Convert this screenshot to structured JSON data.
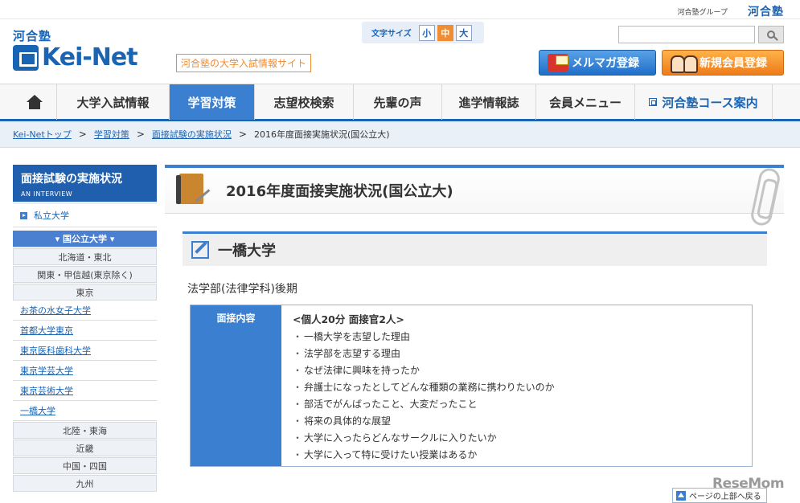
{
  "topbar": {
    "group_label": "河合塾グループ",
    "kawai_logo": "河合塾"
  },
  "logo": {
    "kawai": "河合塾",
    "brand": "Kei-Net",
    "tagline": "河合塾の大学入試情報サイト"
  },
  "font_size": {
    "label": "文字サイズ",
    "options": [
      "小",
      "中",
      "大"
    ],
    "selected": "中"
  },
  "search": {
    "value": "",
    "placeholder": ""
  },
  "buttons": {
    "mailmag": "メルマガ登録",
    "register": "新規会員登録"
  },
  "gnav": {
    "items": [
      "大学入試情報",
      "学習対策",
      "志望校検索",
      "先輩の声",
      "進学情報誌",
      "会員メニュー",
      "河合塾コース案内"
    ],
    "active": "学習対策"
  },
  "breadcrumb": {
    "items": [
      "Kei-Netトップ",
      "学習対策",
      "面接試験の実施状況"
    ],
    "current": "2016年度面接実施状況(国公立大)"
  },
  "sidebar": {
    "title": "面接試験の実施状況",
    "subtitle": "AN INTERVIEW",
    "private": "私立大学",
    "current": "▾ 国公立大学 ▾",
    "regions_top": [
      "北海道・東北",
      "関東・甲信越(東京除く)",
      "東京"
    ],
    "tokyo_unis": [
      "お茶の水女子大学",
      "首都大学東京",
      "東京医科歯科大学",
      "東京学芸大学",
      "東京芸術大学",
      "一橋大学"
    ],
    "regions_bottom": [
      "北陸・東海",
      "近畿",
      "中国・四国",
      "九州"
    ]
  },
  "main": {
    "page_title": "2016年度面接実施状況(国公立大)",
    "university": "一橋大学",
    "department": "法学部(法律学科)後期",
    "box_label": "面接内容",
    "box_head": "<個人20分 面接官2人>",
    "questions": [
      "一橋大学を志望した理由",
      "法学部を志望する理由",
      "なぜ法律に興味を持ったか",
      "弁護士になったとしてどんな種類の業務に携わりたいのか",
      "部活でがんばったこと、大変だったこと",
      "将来の具体的な展望",
      "大学に入ったらどんなサークルに入りたいか",
      "大学に入って特に受けたい授業はあるか"
    ]
  },
  "page_top": "ページの上部へ戻る",
  "watermark": "ReseMom"
}
